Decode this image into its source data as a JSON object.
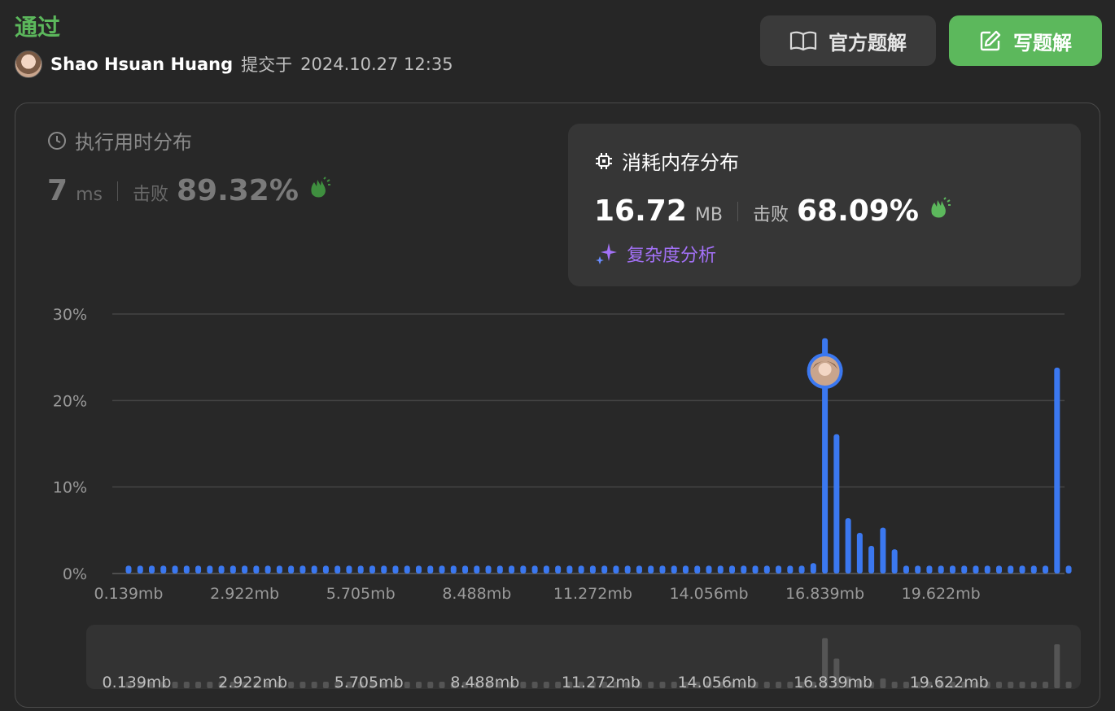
{
  "header": {
    "status": "通过",
    "user": "Shao Hsuan Huang",
    "submitted_label": "提交于",
    "submitted_time": "2024.10.27 12:35"
  },
  "buttons": {
    "solution": "官方题解",
    "write": "写题解"
  },
  "runtime": {
    "title": "执行用时分布",
    "value": "7",
    "unit": "ms",
    "beat_label": "击败",
    "beat_pct": "89.32%"
  },
  "memory": {
    "title": "消耗内存分布",
    "value": "16.72",
    "unit": "MB",
    "beat_label": "击败",
    "beat_pct": "68.09%",
    "analysis_label": "复杂度分析"
  },
  "colors": {
    "accepted": "#5cb85c",
    "bar": "#3b78f0",
    "analysis": "#a371f7"
  },
  "chart_data": {
    "type": "bar",
    "ylabel": "",
    "xlabel": "",
    "y_ticks": [
      "0%",
      "10%",
      "20%",
      "30%"
    ],
    "ylim": [
      0,
      30
    ],
    "x_tick_labels": [
      "0.139mb",
      "2.922mb",
      "5.705mb",
      "8.488mb",
      "11.272mb",
      "14.056mb",
      "16.839mb",
      "19.622mb"
    ],
    "user_bar_index": 60,
    "values": [
      0.9,
      0.9,
      0.9,
      0.9,
      0.9,
      0.9,
      0.9,
      0.9,
      0.9,
      0.9,
      0.9,
      0.9,
      0.9,
      0.9,
      0.9,
      0.9,
      0.9,
      0.9,
      0.9,
      0.9,
      0.9,
      0.9,
      0.9,
      0.9,
      0.9,
      0.9,
      0.9,
      0.9,
      0.9,
      0.9,
      0.9,
      0.9,
      0.9,
      0.9,
      0.9,
      0.9,
      0.9,
      0.9,
      0.9,
      0.9,
      0.9,
      0.9,
      0.9,
      0.9,
      0.9,
      0.9,
      0.9,
      0.9,
      0.9,
      0.9,
      0.9,
      0.9,
      0.9,
      0.9,
      0.9,
      0.9,
      0.9,
      0.9,
      0.9,
      1.2,
      27.2,
      16.1,
      6.4,
      4.7,
      3.2,
      5.3,
      2.8,
      0.9,
      0.9,
      0.9,
      0.9,
      0.9,
      0.9,
      0.9,
      0.9,
      0.9,
      0.9,
      0.9,
      0.9,
      0.9,
      23.8,
      0.9
    ]
  }
}
